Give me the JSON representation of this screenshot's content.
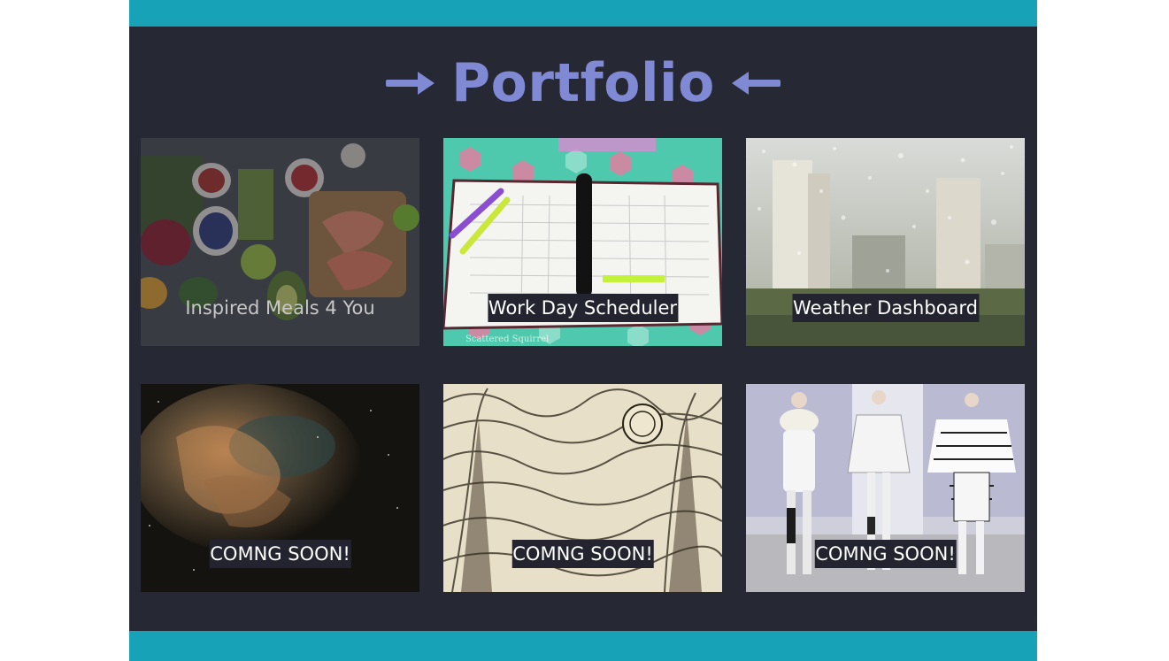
{
  "title": "Portfolio",
  "icons": {
    "left_arrow": "arrow-right-icon",
    "right_arrow": "arrow-left-icon"
  },
  "colors": {
    "accent": "#17a2b8",
    "background": "#262834",
    "title": "#7f89d4"
  },
  "projects": [
    {
      "caption": "Inspired Meals 4 You",
      "image": "vegetables-and-salmon-image"
    },
    {
      "caption": "Work Day Scheduler",
      "image": "planner-notebook-image",
      "watermark": "Scattered Squirrel"
    },
    {
      "caption": "Weather Dashboard",
      "image": "rainy-city-window-image"
    },
    {
      "caption": "COMNG SOON!",
      "image": "nebula-image"
    },
    {
      "caption": "COMNG SOON!",
      "image": "starry-night-sketch-image"
    },
    {
      "caption": "COMNG SOON!",
      "image": "fashion-runway-image"
    }
  ]
}
